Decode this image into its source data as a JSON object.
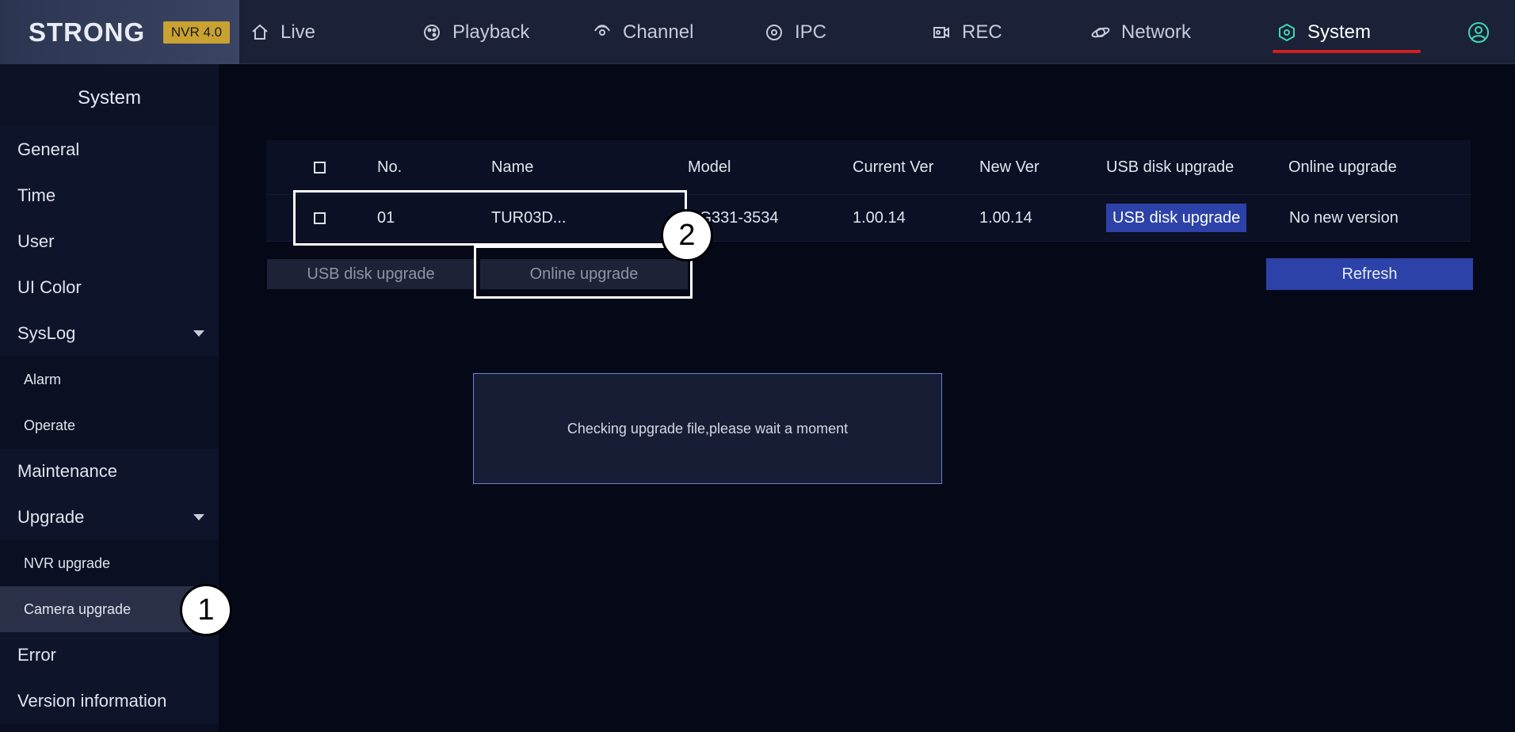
{
  "brand": {
    "name": "STRONG",
    "badge": "NVR 4.0"
  },
  "nav": [
    {
      "label": "Live",
      "icon": "home-icon"
    },
    {
      "label": "Playback",
      "icon": "playback-icon"
    },
    {
      "label": "Channel",
      "icon": "channel-icon"
    },
    {
      "label": "IPC",
      "icon": "ipc-icon"
    },
    {
      "label": "REC",
      "icon": "rec-icon"
    },
    {
      "label": "Network",
      "icon": "network-icon"
    },
    {
      "label": "System",
      "icon": "system-icon",
      "active": true
    }
  ],
  "sidebar": {
    "title": "System",
    "items": [
      {
        "label": "General"
      },
      {
        "label": "Time"
      },
      {
        "label": "User"
      },
      {
        "label": "UI Color"
      },
      {
        "label": "SysLog"
      },
      {
        "label": "Alarm"
      },
      {
        "label": "Operate"
      },
      {
        "label": "Maintenance"
      },
      {
        "label": "Upgrade"
      },
      {
        "label": "NVR upgrade"
      },
      {
        "label": "Camera upgrade",
        "selected": true
      },
      {
        "label": "Error"
      },
      {
        "label": "Version information"
      }
    ]
  },
  "table": {
    "headers": {
      "no": "No.",
      "name": "Name",
      "model": "Model",
      "current": "Current Ver",
      "new": "New Ver",
      "usb": "USB disk upgrade",
      "online": "Online upgrade"
    },
    "rows": [
      {
        "no": "01",
        "name": "TUR03D...",
        "model": "CG331-3534",
        "current": "1.00.14",
        "new": "1.00.14",
        "usb": "USB disk upgrade",
        "online": "No new version"
      }
    ]
  },
  "buttons": {
    "usb_upgrade": "USB disk upgrade",
    "online_upgrade": "Online upgrade",
    "refresh": "Refresh"
  },
  "dialog": {
    "message": "Checking upgrade file,please wait a moment"
  },
  "annotations": {
    "step1": "1",
    "step2": "2"
  },
  "colors": {
    "accent": "#2c42a8",
    "active_underline": "#d21f1f",
    "badge": "#c9a232"
  }
}
